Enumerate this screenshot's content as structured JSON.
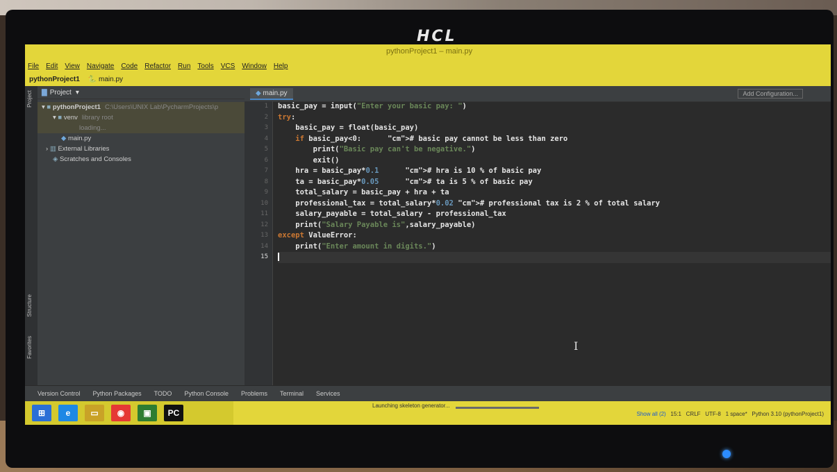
{
  "brand": "HCL",
  "window": {
    "title": "pythonProject1 – main.py",
    "menu": [
      "File",
      "Edit",
      "View",
      "Navigate",
      "Code",
      "Refactor",
      "Run",
      "Tools",
      "VCS",
      "Window",
      "Help"
    ],
    "breadcrumb_project": "pythonProject1",
    "breadcrumb_file": "main.py"
  },
  "project_panel": {
    "title": "Project",
    "tree": [
      {
        "label": "pythonProject1",
        "hint": "C:\\Users\\UNIX Lab\\PycharmProjects\\p"
      },
      {
        "label": "venv",
        "hint": "library root"
      },
      {
        "label": "",
        "hint": "loading..."
      },
      {
        "label": "main.py",
        "hint": ""
      },
      {
        "label": "External Libraries",
        "hint": ""
      },
      {
        "label": "Scratches and Consoles",
        "hint": ""
      }
    ]
  },
  "editor": {
    "tab": "main.py",
    "add_configuration": "Add Configuration...",
    "current_line": 15,
    "code_lines": [
      "basic_pay = input(\"Enter your basic pay: \")",
      "try:",
      "    basic_pay = float(basic_pay)",
      "    if basic_pay<0:      # basic pay cannot be less than zero",
      "        print(\"Basic pay can't be negative.\")",
      "        exit()",
      "    hra = basic_pay*0.1      # hra is 10 % of basic pay",
      "    ta = basic_pay*0.05      # ta is 5 % of basic pay",
      "    total_salary = basic_pay + hra + ta",
      "    professional_tax = total_salary*0.02 # professional tax is 2 % of total salary",
      "    salary_payable = total_salary - professional_tax",
      "    print(\"Salary Payable is\",salary_payable)",
      "except ValueError:",
      "    print(\"Enter amount in digits.\")",
      ""
    ]
  },
  "left_strip": {
    "project": "Project",
    "structure": "Structure",
    "favorites": "Favorites"
  },
  "bottom_tools": [
    "Version Control",
    "Python Packages",
    "TODO",
    "Python Console",
    "Problems",
    "Terminal",
    "Services"
  ],
  "status": {
    "task": "Launching skeleton generator...",
    "show_all": "Show all (2)",
    "position": "15:1",
    "line_sep": "CRLF",
    "encoding": "UTF-8",
    "indent": "1 space*",
    "interpreter": "Python 3.10 (pythonProject1)"
  },
  "taskbar_icons": [
    "windows-start-icon",
    "internet-explorer-icon",
    "file-explorer-icon",
    "chrome-icon",
    "store-icon",
    "pycharm-icon"
  ]
}
